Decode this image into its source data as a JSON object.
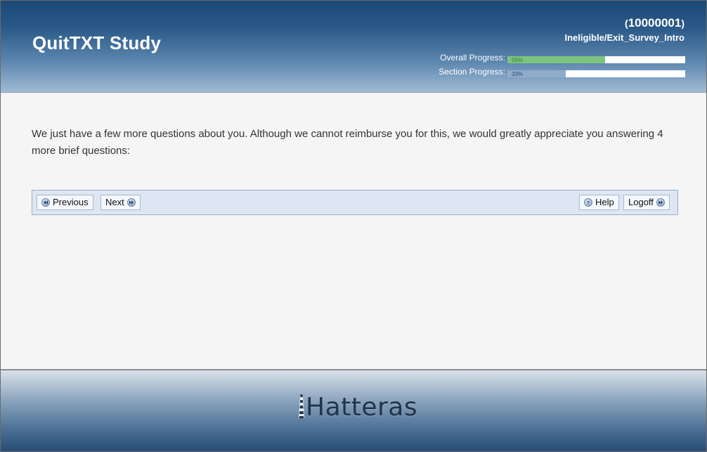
{
  "header": {
    "study_title": "QuitTXT Study",
    "user_id": "10000001",
    "page_path": "Ineligible/Exit_Survey_Intro",
    "overall_progress": {
      "label": "Overall Progress:",
      "value_text": "55%",
      "value": 0.55,
      "color": "#7dc47e",
      "text_color": "#2f7a31"
    },
    "section_progress": {
      "label": "Section Progress:",
      "value_text": "33%",
      "value": 0.33,
      "color": "#8fadc9",
      "text_color": "#2c4b6c"
    }
  },
  "main": {
    "message": "We just have a few more questions about you. Although we cannot reimburse you for this, we would greatly appreciate you answering 4 more brief questions:"
  },
  "navbar": {
    "previous_label": "Previous",
    "next_label": "Next",
    "help_label": "Help",
    "logoff_label": "Logoff"
  },
  "footer": {
    "logo_text": "Hatteras"
  },
  "icons": {
    "previous": "rewind-icon",
    "next": "fast-forward-icon",
    "help": "help-icon",
    "logoff": "fast-forward-icon",
    "logo": "lighthouse-icon"
  }
}
